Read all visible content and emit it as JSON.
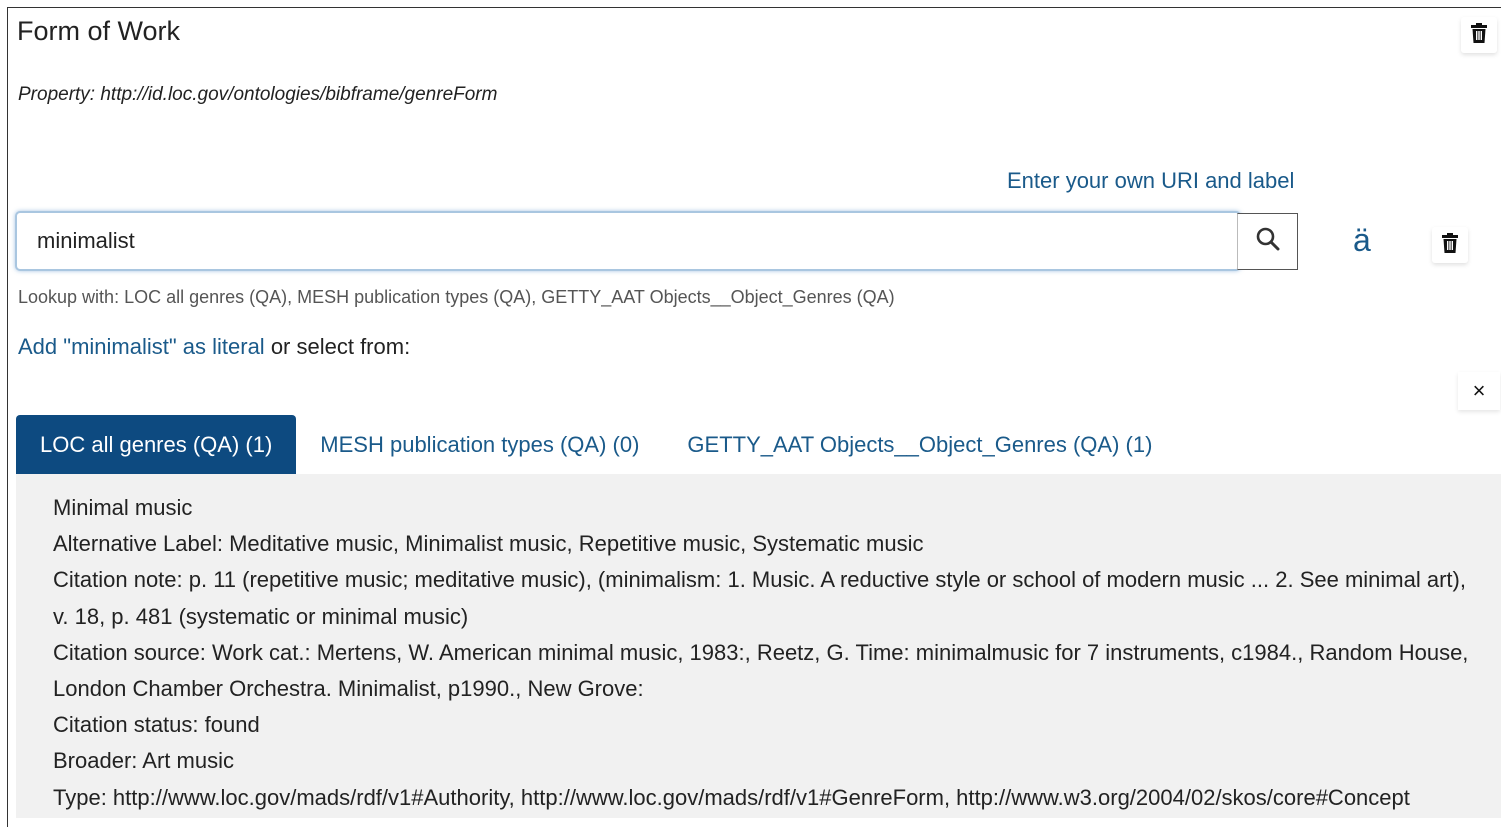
{
  "header": {
    "title": "Form of Work",
    "property": "Property: http://id.loc.gov/ontologies/bibframe/genreForm"
  },
  "actions": {
    "own_uri_label": "Enter your own URI and label",
    "diacritic_label": "ä"
  },
  "search": {
    "value": "minimalist",
    "lookup_text": "Lookup with: LOC all genres (QA), MESH publication types (QA), GETTY_AAT Objects__Object_Genres (QA)"
  },
  "literal": {
    "link_text": "Add \"minimalist\" as literal",
    "suffix_text": " or select from:"
  },
  "close_label": "×",
  "tabs": [
    {
      "label": "LOC all genres (QA) (1)",
      "active": true
    },
    {
      "label": "MESH publication types (QA) (0)",
      "active": false
    },
    {
      "label": "GETTY_AAT Objects__Object_Genres (QA) (1)",
      "active": false
    }
  ],
  "result": {
    "lines": [
      "Minimal music",
      "Alternative Label: Meditative music, Minimalist music, Repetitive music, Systematic music",
      "Citation note: p. 11 (repetitive music; meditative music), (minimalism: 1. Music. A reductive style or school of modern music ... 2. See minimal art),",
      "v. 18, p. 481 (systematic or minimal music)",
      "Citation source: Work cat.: Mertens, W. American minimal music, 1983:, Reetz, G. Time: minimalmusic for 7 instruments, c1984., Random House,",
      "London Chamber Orchestra. Minimalist, p1990., New Grove:",
      "Citation status: found",
      "Broader: Art music",
      "Type: http://www.loc.gov/mads/rdf/v1#Authority, http://www.loc.gov/mads/rdf/v1#GenreForm, http://www.w3.org/2004/02/skos/core#Concept"
    ]
  },
  "colors": {
    "link": "#1a5a8a",
    "active_tab": "#0d4a80",
    "results_bg": "#f1f1f1"
  },
  "icons": {
    "trash": "trash-icon",
    "search": "search-icon",
    "close": "close-icon"
  }
}
